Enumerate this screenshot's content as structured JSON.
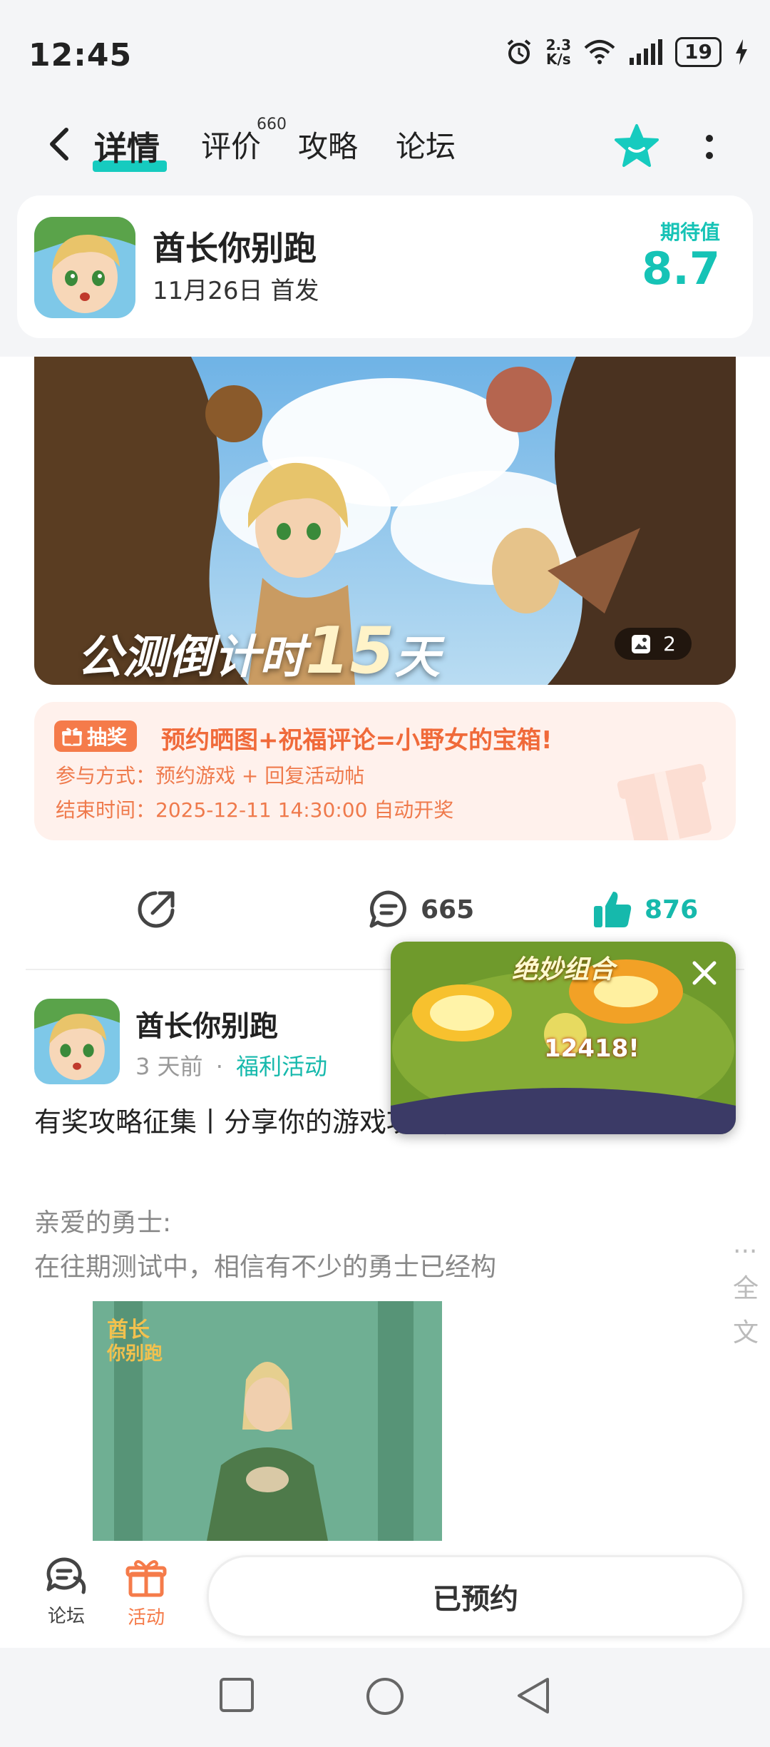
{
  "status_bar": {
    "time": "12:45",
    "speed_top": "2.3",
    "speed_bottom": "K/s",
    "battery": "19"
  },
  "nav": {
    "tabs": [
      {
        "label": "详情",
        "active": true
      },
      {
        "label": "评价",
        "badge": "660"
      },
      {
        "label": "攻略"
      },
      {
        "label": "论坛"
      }
    ]
  },
  "game": {
    "name": "酋长你别跑",
    "release": "11月26日 首发",
    "expect_label": "期待值",
    "expect_value": "8.7"
  },
  "banner": {
    "caption_prefix": "公测倒计时",
    "caption_number": "15",
    "caption_suffix": "天",
    "image_count": "2"
  },
  "promo": {
    "badge": "抽奖",
    "title": "预约晒图+祝福评论=小野女的宝箱!",
    "participation": "参与方式：预约游戏 + 回复活动帖",
    "end_time": "结束时间：2025-12-11 14:30:00 自动开奖"
  },
  "actions": {
    "comments": "665",
    "likes": "876"
  },
  "post": {
    "author": "酋长你别跑",
    "time": "3 天前",
    "separator": "·",
    "category": "福利活动",
    "title": "有奖攻略征集丨分享你的游戏攻略，赢取丰厚奖励!",
    "body_line1": "亲爱的勇士:",
    "body_line2": "在往期测试中，相信有不少的勇士已经构",
    "more": "... 全文"
  },
  "float_video": {
    "title": "绝妙组合",
    "score": "12418!"
  },
  "bottom": {
    "forum_label": "论坛",
    "activity_label": "活动",
    "reserve_label": "已预约"
  },
  "colors": {
    "accent": "#16cbbf",
    "orange": "#f57b4a",
    "like": "#16b9ac"
  }
}
